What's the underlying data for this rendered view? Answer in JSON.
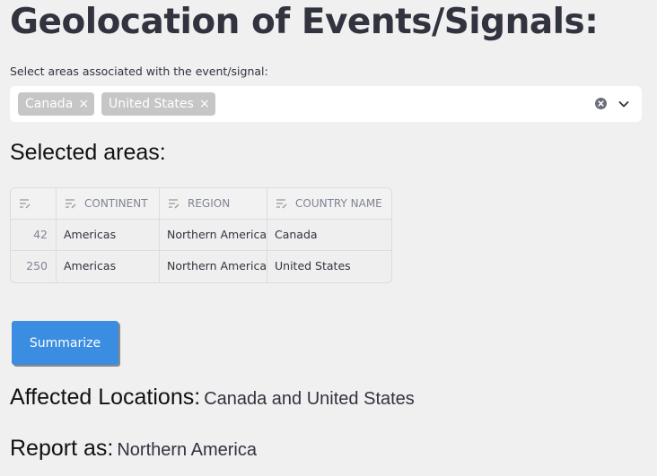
{
  "page": {
    "title": "Geolocation of Events/Signals:"
  },
  "area_select": {
    "label": "Select areas associated with the event/signal:",
    "selected": [
      {
        "label": "Canada",
        "remove": "×"
      },
      {
        "label": "United States",
        "remove": "×"
      }
    ],
    "clear_icon": "circle-x-icon",
    "dropdown_icon": "chevron-down-icon"
  },
  "selected_areas": {
    "heading": "Selected areas:",
    "columns": [
      "",
      "CONTINENT",
      "REGION",
      "COUNTRY NAME"
    ],
    "column_icon": "sort-lines-icon",
    "rows": [
      {
        "index": "42",
        "continent": "Americas",
        "region": "Northern America",
        "country": "Canada"
      },
      {
        "index": "250",
        "continent": "Americas",
        "region": "Northern America",
        "country": "United States"
      }
    ]
  },
  "actions": {
    "summarize_label": "Summarize"
  },
  "results": {
    "affected_label": "Affected Locations:",
    "affected_value": "Canada and United States",
    "report_label": "Report as:",
    "report_value": "Northern America"
  },
  "colors": {
    "background": "#f0f0f0",
    "primary_button": "#3b8de1",
    "tag_background": "#c6c6c6"
  }
}
